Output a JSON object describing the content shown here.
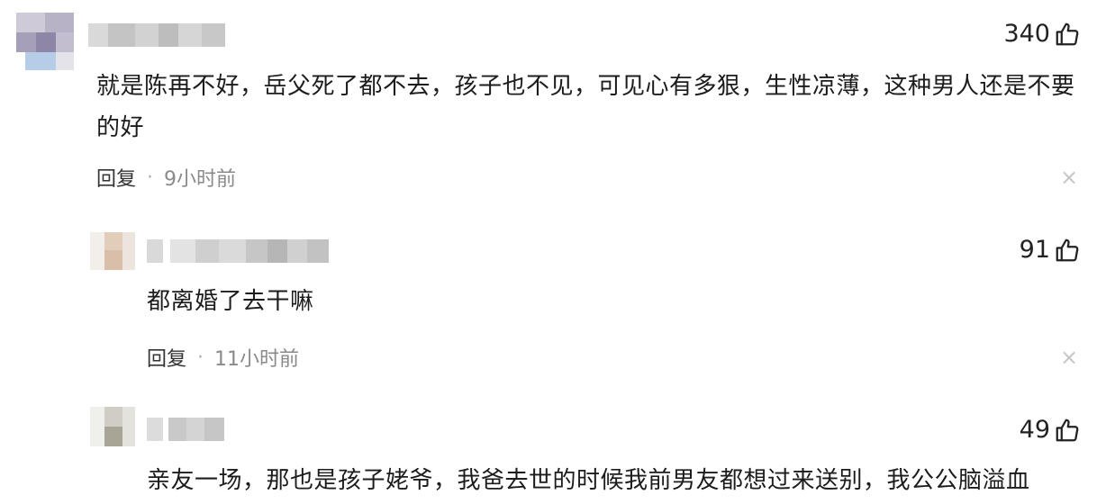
{
  "comments": [
    {
      "likes": "340",
      "text": "就是陈再不好，岳父死了都不去，孩子也不见，可见心有多狠，生性凉薄，这种男人还是不要的好",
      "reply_label": "回复",
      "separator": "·",
      "time": "9小时前",
      "close_symbol": "×"
    },
    {
      "likes": "91",
      "text": "都离婚了去干嘛",
      "reply_label": "回复",
      "separator": "·",
      "time": "11小时前",
      "close_symbol": "×"
    },
    {
      "likes": "49",
      "text": "亲友一场，那也是孩子姥爷，我爸去世的时候我前男友都想过来送别，我公公脑溢血"
    }
  ],
  "icons": {
    "like": "thumbs-up-icon",
    "close": "close-icon"
  },
  "colors": {
    "meta_gray": "#8a8a8a",
    "close_gray": "#c6c6c6",
    "text": "#1c1c1c"
  }
}
